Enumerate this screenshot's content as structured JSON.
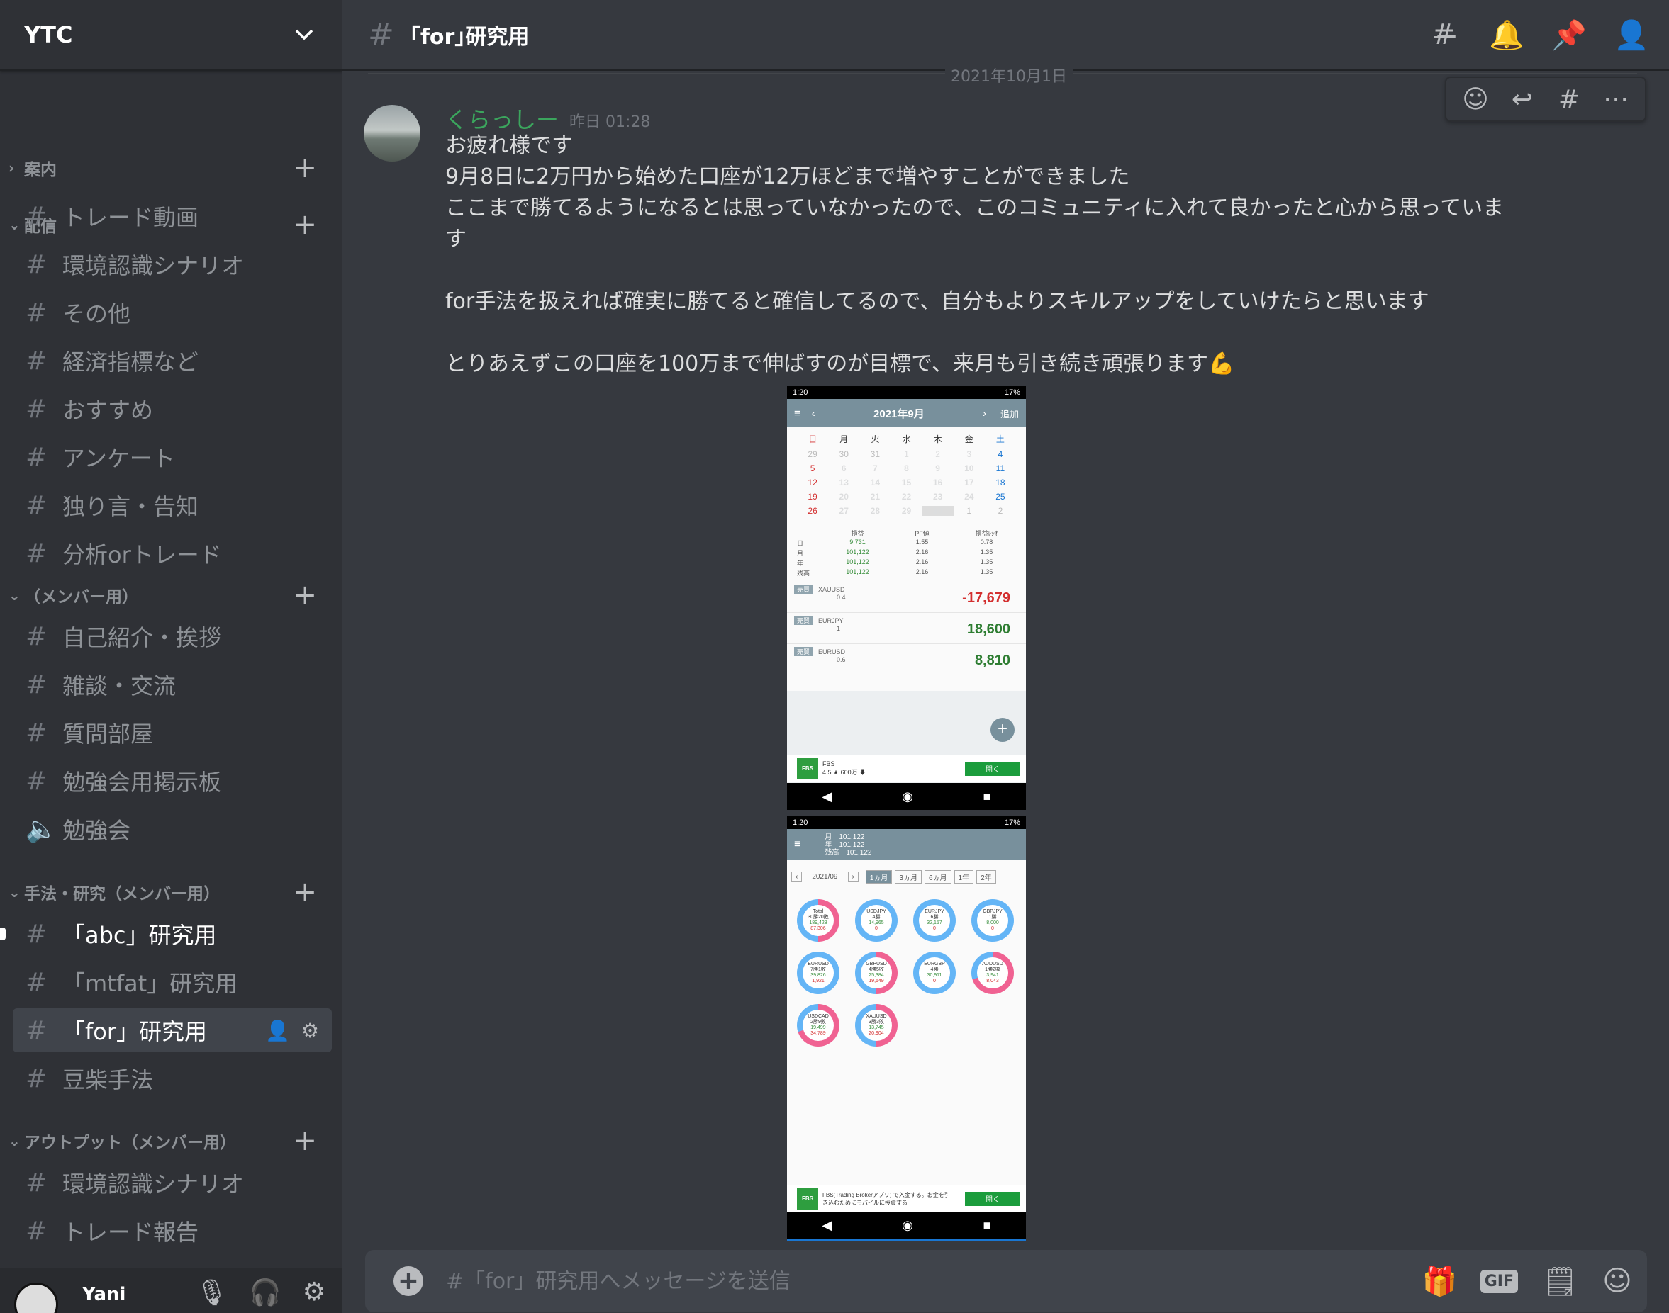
{
  "server": {
    "name": "YTC"
  },
  "sidebar": {
    "categories": [
      {
        "name": "案内"
      },
      {
        "name": "配信"
      },
      {
        "name": "（メンバー用）"
      },
      {
        "name": "手法・研究（メンバー用）"
      },
      {
        "name": "アウトプット（メンバー用）"
      }
    ],
    "channels": {
      "haishin": [
        "トレード動画",
        "環境認識シナリオ",
        "その他",
        "経済指標など",
        "おすすめ",
        "アンケート",
        "独り言・告知",
        "分析orトレード"
      ],
      "member": [
        "自己紹介・挨拶",
        "雑談・交流",
        "質問部屋",
        "勉強会用掲示板",
        "勉強会"
      ],
      "shuho": [
        "「abc」研究用",
        "「mtfat」研究用",
        "「for」研究用",
        "豆柴手法"
      ],
      "output": [
        "環境認識シナリオ",
        "トレード報告"
      ]
    }
  },
  "user": {
    "name": "Yani"
  },
  "channel": {
    "title": "｢for｣研究用"
  },
  "date_divider": "2021年10月1日",
  "message": {
    "author": "くらっしー",
    "timestamp": "昨日 01:28",
    "body": "お疲れ様です\n9月8日に2万円から始めた口座が12万ほどまで増やすことができました\nここまで勝てるようになるとは思っていなかったので、このコミュニティに入れて良かったと心から思っていま\nす\n\nfor手法を扱えれば確実に勝てると確信してるので、自分もよりスキルアップをしていけたらと思います\n\nとりあえずこの口座を100万まで伸ばすのが目標で、来月も引き続き頑張ります💪"
  },
  "phone1": {
    "status_time": "1:20",
    "status_right": "17%",
    "bar_title": "2021年9月",
    "bar_add": "追加",
    "weekdays": [
      "日",
      "月",
      "火",
      "水",
      "木",
      "金",
      "土"
    ],
    "weeks": [
      [
        "29",
        "30",
        "31",
        "1",
        "2",
        "3",
        "4"
      ],
      [
        "5",
        "6",
        "7",
        "8",
        "9",
        "10",
        "11"
      ],
      [
        "12",
        "13",
        "14",
        "15",
        "16",
        "17",
        "18"
      ],
      [
        "19",
        "20",
        "21",
        "22",
        "23",
        "24",
        "25"
      ],
      [
        "26",
        "27",
        "28",
        "29",
        "30",
        "1",
        "2"
      ]
    ],
    "summary_headers": [
      "損益",
      "PF値",
      "損益ﾚｼｵ"
    ],
    "summary_rows": [
      {
        "label": "日",
        "v": [
          "9,731",
          "1.55",
          "0.78"
        ]
      },
      {
        "label": "月",
        "v": [
          "101,122",
          "2.16",
          "1.35"
        ]
      },
      {
        "label": "年",
        "v": [
          "101,122",
          "2.16",
          "1.35"
        ]
      },
      {
        "label": "残高",
        "v": [
          "101,122",
          "2.16",
          "1.35"
        ]
      }
    ],
    "trades": [
      {
        "tag": "売買",
        "pair": "XAUUSD",
        "qty": "0.4",
        "amount": "-17,679"
      },
      {
        "tag": "売買",
        "pair": "EURJPY",
        "qty": "1",
        "amount": "18,600"
      },
      {
        "tag": "売買",
        "pair": "EURUSD",
        "qty": "0.6",
        "amount": "8,810"
      }
    ],
    "ad": {
      "name": "FBS",
      "rating": "4.5 ★ 600万 ⬇",
      "button": "開く"
    }
  },
  "phone2": {
    "status_time": "1:20",
    "status_right": "17%",
    "bar_lines": [
      "月　101,122",
      "年　101,122",
      "残高　101,122"
    ],
    "period": "2021/09",
    "tabs": [
      "1ヵ月",
      "3ヵ月",
      "6ヵ月",
      "1年",
      "2年"
    ],
    "donuts": [
      {
        "label": "Total",
        "l2": "30勝20敗",
        "l3": "189,428",
        "l4": "87,306",
        "style": "mix"
      },
      {
        "label": "USDJPY",
        "l2": "4勝",
        "l3": "14,965",
        "l4": "0",
        "style": "b"
      },
      {
        "label": "EURJPY",
        "l2": "6勝",
        "l3": "32,157",
        "l4": "0",
        "style": "b"
      },
      {
        "label": "GBPJPY",
        "l2": "1勝",
        "l3": "8,000",
        "l4": "0",
        "style": "b"
      },
      {
        "label": "EURUSD",
        "l2": "7勝1敗",
        "l3": "39,826",
        "l4": "1,921",
        "style": "b"
      },
      {
        "label": "GBPUSD",
        "l2": "4勝5敗",
        "l3": "25,384",
        "l4": "19,649",
        "style": "mix"
      },
      {
        "label": "EURGBP",
        "l2": "4勝",
        "l3": "30,911",
        "l4": "0",
        "style": "b"
      },
      {
        "label": "AUDUSD",
        "l2": "1勝2敗",
        "l3": "3,941",
        "l4": "8,043",
        "style": "r"
      },
      {
        "label": "USDCAD",
        "l2": "2勝9敗",
        "l3": "19,499",
        "l4": "34,789",
        "style": "r"
      },
      {
        "label": "XAUUSD",
        "l2": "3勝3敗",
        "l3": "13,745",
        "l4": "20,904",
        "style": "mix"
      }
    ],
    "ad": {
      "name": "FBS",
      "text": "FBS(Trading Brokerアプリ) で入金する。お金を引き込むためにモバイルに投資する",
      "button": "開く"
    }
  },
  "composer": {
    "placeholder": "#「for」研究用へメッセージを送信"
  },
  "colors": {
    "accent_green": "#3ba55d",
    "sidebar": "#2f3136",
    "main": "#36393f"
  }
}
